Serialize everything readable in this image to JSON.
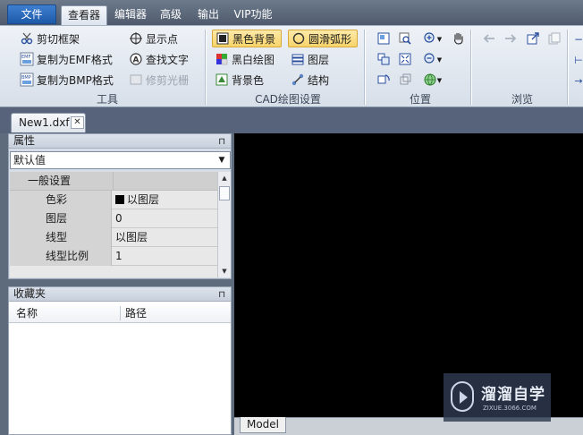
{
  "menu": {
    "file": "文件",
    "tabs": [
      "查看器",
      "编辑器",
      "高级",
      "输出",
      "VIP功能"
    ],
    "active_tab": "查看器"
  },
  "ribbon": {
    "tools": {
      "label": "工具",
      "clip_frame": "剪切框架",
      "copy_emf": "复制为EMF格式",
      "copy_bmp": "复制为BMP格式",
      "show_point": "显示点",
      "find_text": "查找文字",
      "trim_raster": "修剪光栅"
    },
    "cad_settings": {
      "label": "CAD绘图设置",
      "black_bg": "黑色背景",
      "bw_draw": "黑白绘图",
      "bg_color": "背景色",
      "smooth_arc": "圆滑弧形",
      "layers": "图层",
      "structure": "结构"
    },
    "position": {
      "label": "位置"
    },
    "browse": {
      "label": "浏览"
    }
  },
  "document": {
    "tab_label": "New1.dxf",
    "close_glyph": "✕"
  },
  "properties": {
    "title": "属性",
    "pin_glyph": "⊓",
    "combo_value": "默认值",
    "group": "一般设置",
    "rows": [
      {
        "key": "色彩",
        "value": "以图层",
        "swatch": "#000000"
      },
      {
        "key": "图层",
        "value": "0"
      },
      {
        "key": "线型",
        "value": "以图层"
      },
      {
        "key": "线型比例",
        "value": "1"
      }
    ]
  },
  "favorites": {
    "title": "收藏夹",
    "col_name": "名称",
    "col_path": "路径"
  },
  "canvas": {
    "background": "#000000",
    "model_tab": "Model"
  },
  "watermark": {
    "title": "溜溜自学",
    "url": "ZIXUE.3066.COM"
  }
}
